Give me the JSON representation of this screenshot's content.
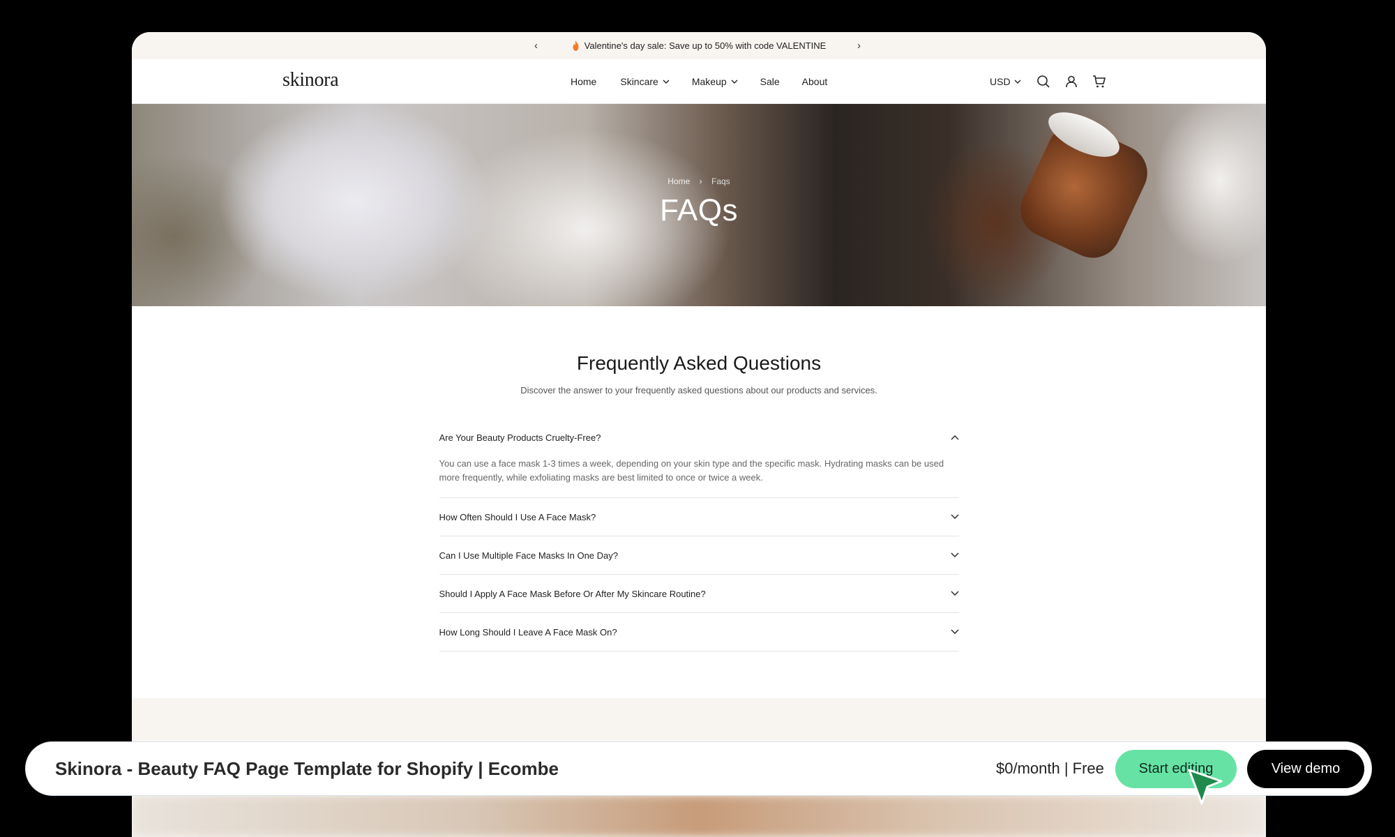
{
  "announcement": {
    "prev_glyph": "‹",
    "next_glyph": "›",
    "icon": "flame-icon",
    "text": "Valentine's day sale: Save up to 50% with code VALENTINE"
  },
  "header": {
    "logo": "skinora",
    "nav": [
      {
        "label": "Home",
        "has_dropdown": false
      },
      {
        "label": "Skincare",
        "has_dropdown": true
      },
      {
        "label": "Makeup",
        "has_dropdown": true
      },
      {
        "label": "Sale",
        "has_dropdown": false
      },
      {
        "label": "About",
        "has_dropdown": false
      }
    ],
    "currency": "USD",
    "icons": [
      "search-icon",
      "account-icon",
      "cart-icon"
    ]
  },
  "hero": {
    "breadcrumb": {
      "home": "Home",
      "separator": "›",
      "current": "Faqs"
    },
    "title": "FAQs"
  },
  "faq": {
    "title": "Frequently Asked Questions",
    "subtitle": "Discover the answer to your frequently asked questions about our products and services.",
    "items": [
      {
        "question": "Are Your Beauty Products Cruelty-Free?",
        "answer": "You can use a face mask 1-3 times a week, depending on your skin type and the specific mask. Hydrating masks can be used more frequently, while exfoliating masks are best limited to once or twice a week.",
        "open": true
      },
      {
        "question": "How Often Should I Use A Face Mask?",
        "open": false
      },
      {
        "question": "Can I Use Multiple Face Masks In One Day?",
        "open": false
      },
      {
        "question": "Should I Apply A Face Mask Before Or After My Skincare Routine?",
        "open": false
      },
      {
        "question": "How Long Should I Leave A Face Mask On?",
        "open": false
      }
    ]
  },
  "bottom_bar": {
    "title": "Skinora - Beauty FAQ Page Template for Shopify | Ecombe",
    "price": "$0/month | Free",
    "start_label": "Start editing",
    "demo_label": "View demo"
  },
  "colors": {
    "start_button": "#66e3a4",
    "demo_button": "#000000",
    "announcement_bg": "#f8f5f1",
    "cursor": "#1f8a4c"
  }
}
